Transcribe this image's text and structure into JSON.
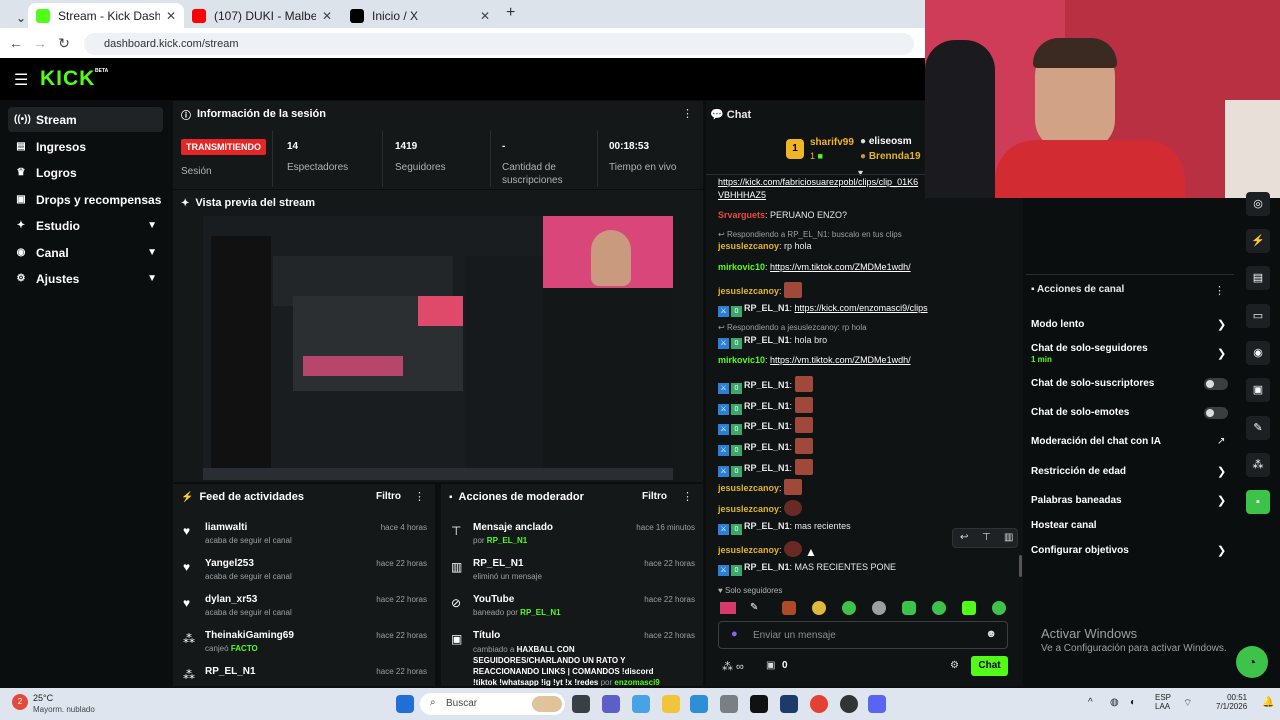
{
  "browser": {
    "tabs": [
      {
        "title": "Stream - Kick Dashboard",
        "active": true
      },
      {
        "title": "(107) DUKI - Malbec x Bizarrap",
        "active": false
      },
      {
        "title": "Inicio / X",
        "active": false
      }
    ],
    "url": "dashboard.kick.com/stream"
  },
  "brand": {
    "logo": "KICK",
    "beta": "BETA",
    "accent": "#53fc18"
  },
  "sidebar": {
    "items": [
      {
        "label": "Stream",
        "icon": "broadcast-icon"
      },
      {
        "label": "Ingresos",
        "icon": "revenue-icon"
      },
      {
        "label": "Logros",
        "icon": "trophy-icon"
      },
      {
        "label": "Drops y recompensas",
        "icon": "gift-icon"
      },
      {
        "label": "Estudio",
        "icon": "studio-icon"
      },
      {
        "label": "Canal",
        "icon": "channel-icon"
      },
      {
        "label": "Ajustes",
        "icon": "gear-icon"
      }
    ]
  },
  "session": {
    "title": "Información de la sesión",
    "live": "TRANSMITIENDO",
    "live_label": "Sesión",
    "stats": [
      {
        "value": "14",
        "label": "Espectadores"
      },
      {
        "value": "1419",
        "label": "Seguidores"
      },
      {
        "value": "-",
        "label": "Cantidad de suscripciones"
      },
      {
        "value": "00:18:53",
        "label": "Tiempo en vivo"
      }
    ]
  },
  "preview": {
    "title": "Vista previa del stream"
  },
  "activity": {
    "title": "Feed de actividades",
    "filter": "Filtro",
    "rows": [
      {
        "name": "liamwalti",
        "sub": "acaba de seguir el canal",
        "time": "hace 4 horas"
      },
      {
        "name": "Yangel253",
        "sub": "acaba de seguir el canal",
        "time": "hace 22 horas"
      },
      {
        "name": "dylan_xr53",
        "sub": "acaba de seguir el canal",
        "time": "hace 22 horas"
      },
      {
        "name": "TheinakiGaming69",
        "sub_prefix": "canjeó",
        "sub_green": "FACTO",
        "time": "hace 22 horas"
      },
      {
        "name": "RP_EL_N1",
        "time": "hace 22 horas"
      }
    ]
  },
  "moderator": {
    "title": "Acciones de moderador",
    "filter": "Filtro",
    "rows": [
      {
        "name": "Mensaje anclado",
        "sub_prefix": "por",
        "sub_green": "RP_EL_N1",
        "time": "hace 16 minutos"
      },
      {
        "name": "RP_EL_N1",
        "sub": "eliminó un mensaje",
        "time": "hace 22 horas"
      },
      {
        "name": "YouTube",
        "sub_prefix": "baneado por",
        "sub_green": "RP_EL_N1",
        "time": "hace 22 horas"
      },
      {
        "name": "Título",
        "sub_prefix": "cambiado a",
        "sub_bold": "HAXBALL CON SEGUIDORES/CHARLANDO UN RATO Y REACCIONANDO LINKS | COMANDOS !discord !tiktok !whatsapp !ig !yt !x !redes",
        "sub_suffix": "por",
        "sub_green2": "enzomasci9",
        "time": "hace 22 horas"
      }
    ]
  },
  "chat": {
    "title": "Chat",
    "leaders": [
      {
        "rank": "1",
        "name": "sharifv99",
        "count": "1"
      },
      {
        "name": "eliseosm"
      },
      {
        "name": "Brennda19"
      }
    ],
    "top_link": "https://kick.com/fabriciosuarezpobl/clips/clip_01K6",
    "top_link2": "VBHHHAZ5",
    "messages": [
      {
        "user": "Srvarguets",
        "color": "#e84a3c",
        "text": "PERUANO ENZO?"
      },
      {
        "reply": "Respondiendo a RP_EL_N1: buscalo en tus clips"
      },
      {
        "user": "jesuslezcanoy",
        "color": "#e0b526",
        "text": "rp hola"
      },
      {
        "user": "mirkovic10",
        "color": "#53fc18",
        "link": "https://vm.tiktok.com/ZMDMe1wdh/"
      },
      {
        "user": "jesuslezcanoy",
        "color": "#e0b526",
        "emote": true
      },
      {
        "user": "RP_EL_N1",
        "color": "#fff",
        "link": "https://kick.com/enzomasci9/clips"
      },
      {
        "reply": "Respondiendo a jesuslezcanoy: rp hola"
      },
      {
        "user": "RP_EL_N1",
        "color": "#fff",
        "text": "hola bro"
      },
      {
        "user": "mirkovic10",
        "color": "#53fc18",
        "link": "https://vm.tiktok.com/ZMDMe1wdh/"
      },
      {
        "user": "RP_EL_N1",
        "color": "#fff",
        "emote": true
      },
      {
        "user": "RP_EL_N1",
        "color": "#fff",
        "emote": true
      },
      {
        "user": "RP_EL_N1",
        "color": "#fff",
        "emote": true
      },
      {
        "user": "RP_EL_N1",
        "color": "#fff",
        "emote": true
      },
      {
        "user": "RP_EL_N1",
        "color": "#fff",
        "emote": true
      },
      {
        "user": "jesuslezcanoy",
        "color": "#e0b526",
        "emote": true
      },
      {
        "user": "jesuslezcanoy",
        "color": "#e0b526",
        "emote": true
      },
      {
        "user": "RP_EL_N1",
        "color": "#fff",
        "text": "mas recientes"
      },
      {
        "user": "jesuslezcanoy",
        "color": "#e0b526",
        "emote": true
      },
      {
        "user": "RP_EL_N1",
        "color": "#fff",
        "text": "MAS RECIENTES PONE"
      }
    ],
    "followers_only": "Solo seguidores",
    "input_placeholder": "Enviar un mensaje",
    "points": "0",
    "send": "Chat"
  },
  "channel_actions": {
    "title": "Acciones de canal",
    "items": [
      {
        "label": "Modo lento",
        "kind": "chevron"
      },
      {
        "label": "Chat de solo-seguidores",
        "sub": "1 min",
        "kind": "chevron"
      },
      {
        "label": "Chat de solo-suscriptores",
        "kind": "toggle"
      },
      {
        "label": "Chat de solo-emotes",
        "kind": "toggle"
      },
      {
        "label": "Moderación del chat con IA",
        "kind": "external"
      },
      {
        "label": "Restricción de edad",
        "kind": "chevron"
      },
      {
        "label": "Palabras baneadas",
        "kind": "chevron"
      },
      {
        "label": "Hostear canal",
        "kind": "none"
      },
      {
        "label": "Configurar objetivos",
        "kind": "chevron"
      }
    ]
  },
  "windows": {
    "activate_title": "Activar Windows",
    "activate_sub": "Ve a Configuración para activar Windows."
  },
  "taskbar": {
    "weather_temp": "25°C",
    "weather_desc": "Mayorm. nublado",
    "search": "Buscar",
    "lang": "ESP",
    "lang2": "LAA",
    "time": "00:51",
    "date": "7/1/2026",
    "notif_badge": "2"
  }
}
